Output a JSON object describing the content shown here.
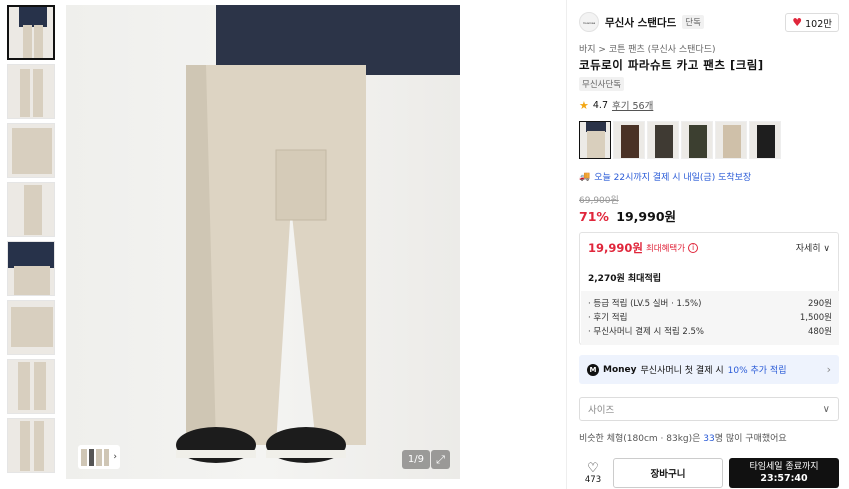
{
  "gallery": {
    "counter": "1/9",
    "thumbnails": 8
  },
  "brand": {
    "name": "무신사 스탠다드",
    "tag": "단독",
    "logo_text": "musinsa standard"
  },
  "like": {
    "count": "102만"
  },
  "breadcrumb": "바지 > 코튼 팬츠 (무신사 스탠다드)",
  "product": {
    "title": "코듀로이 파라슈트 카고 팬츠 [크림]",
    "excl_tag": "무신사단독",
    "rating": "4.7",
    "reviews": "후기 56개",
    "delivery": "오늘 22시까지 결제 시 내일(금) 도착보장",
    "original_price": "69,900원",
    "discount": "71%",
    "price": "19,990원"
  },
  "benefits": {
    "max_price": "19,990원",
    "max_label": "최대혜택가",
    "detail": "자세히 ∨",
    "points_title": "2,270원 최대적립",
    "lines": [
      {
        "label": "· 등급 적립 (LV.5 실버 · 1.5%)",
        "value": "290원"
      },
      {
        "label": "· 후기 적립",
        "value": "1,500원"
      },
      {
        "label": "· 무신사머니 결제 시 적립 2.5%",
        "value": "480원"
      }
    ]
  },
  "money_banner": {
    "badge": "M",
    "money": "Money",
    "text": "무신사머니 첫 결제 시",
    "percent": "10% 추가 적립"
  },
  "size_select": {
    "placeholder": "사이즈"
  },
  "similar": {
    "prefix": "비슷한 체형(180cm · 83kg)은",
    "count": "33",
    "suffix": "명 많이 구매했어요"
  },
  "actions": {
    "like_count": "473",
    "cart": "장바구니",
    "buy_title": "타임세일 종료까지",
    "buy_timer": "23:57:40"
  },
  "colors": {
    "accent_red": "#e0263b",
    "accent_blue": "#2a5bd7"
  }
}
